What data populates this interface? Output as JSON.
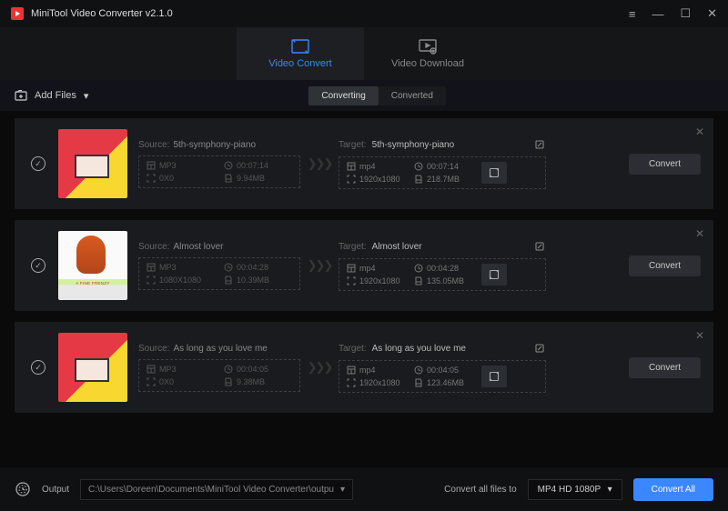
{
  "app": {
    "title": "MiniTool Video Converter v2.1.0"
  },
  "nav": {
    "convert": "Video Convert",
    "download": "Video Download"
  },
  "toolbar": {
    "add_files": "Add Files"
  },
  "subtabs": {
    "converting": "Converting",
    "converted": "Converted"
  },
  "labels": {
    "source": "Source:",
    "target": "Target:",
    "convert": "Convert"
  },
  "items": [
    {
      "thumb_class": "t1",
      "source": {
        "name": "5th-symphony-piano",
        "format": "MP3",
        "duration": "00:07:14",
        "resolution": "0X0",
        "size": "9.94MB"
      },
      "target": {
        "name": "5th-symphony-piano",
        "format": "mp4",
        "duration": "00:07:14",
        "resolution": "1920x1080",
        "size": "218.7MB"
      }
    },
    {
      "thumb_class": "t2",
      "source": {
        "name": "Almost lover",
        "format": "MP3",
        "duration": "00:04:28",
        "resolution": "1080X1080",
        "size": "10.39MB"
      },
      "target": {
        "name": "Almost lover",
        "format": "mp4",
        "duration": "00:04:28",
        "resolution": "1920x1080",
        "size": "135.05MB"
      }
    },
    {
      "thumb_class": "t1",
      "source": {
        "name": "As long as you love me",
        "format": "MP3",
        "duration": "00:04:05",
        "resolution": "0X0",
        "size": "9.38MB"
      },
      "target": {
        "name": "As long as you love me",
        "format": "mp4",
        "duration": "00:04:05",
        "resolution": "1920x1080",
        "size": "123.46MB"
      }
    }
  ],
  "footer": {
    "output_label": "Output",
    "output_path": "C:\\Users\\Doreen\\Documents\\MiniTool Video Converter\\outpu",
    "convert_all_to": "Convert all files to",
    "format": "MP4 HD 1080P",
    "convert_all": "Convert All"
  }
}
